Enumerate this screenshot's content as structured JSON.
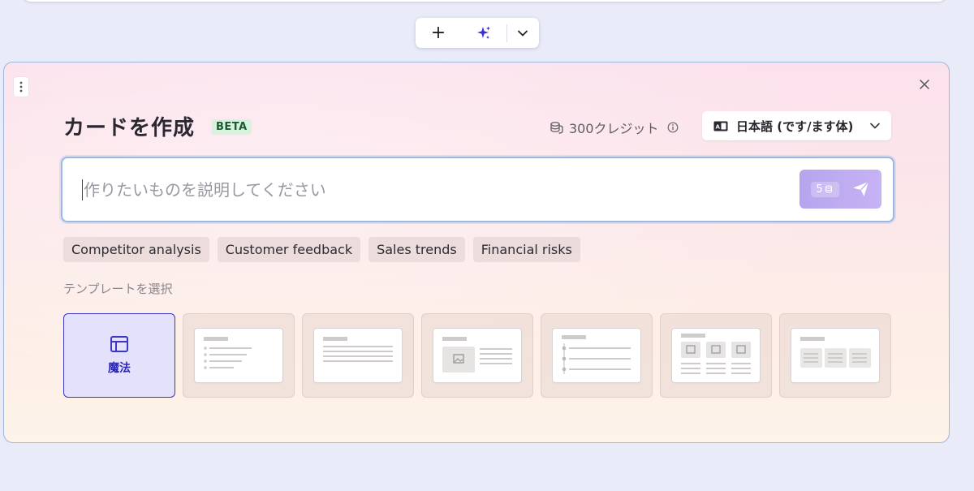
{
  "toolbar": {
    "add_icon": "plus-icon",
    "ai_icon": "sparkles-icon",
    "menu_icon": "chevron-down-icon"
  },
  "panel": {
    "title": "カードを作成",
    "badge": "BETA",
    "credits_text": "300クレジット",
    "language": "日本語 (です/ます体)",
    "prompt": {
      "placeholder": "作りたいものを説明してください",
      "value": "",
      "send_cost": "5"
    },
    "suggestions": [
      "Competitor analysis",
      "Customer feedback",
      "Sales trends",
      "Financial risks"
    ],
    "templates_label": "テンプレートを選択",
    "templates": [
      {
        "label": "魔法",
        "selected": true,
        "icon": "layout-icon"
      },
      {
        "layout": "bulleted-list",
        "selected": false
      },
      {
        "layout": "text-lines",
        "selected": false
      },
      {
        "layout": "image-and-text",
        "selected": false
      },
      {
        "layout": "timeline",
        "selected": false
      },
      {
        "layout": "three-image-columns",
        "selected": false
      },
      {
        "layout": "three-columns",
        "selected": false
      }
    ]
  },
  "colors": {
    "accent": "#3b36c6",
    "send_button": "#b9a7ef",
    "beta_bg": "#d6f3dd"
  }
}
